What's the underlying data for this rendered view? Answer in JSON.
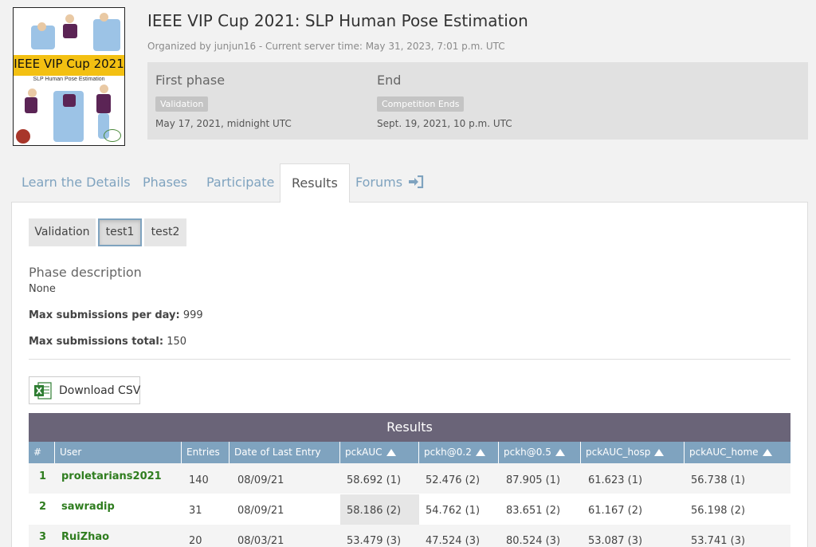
{
  "competition": {
    "title": "IEEE VIP Cup 2021: SLP Human Pose Estimation",
    "organized_by": "Organized by junjun16 - Current server time: May 31, 2023, 7:01 p.m. UTC",
    "logo_title": "IEEE VIP Cup 2021",
    "logo_subtitle": "SLP Human Pose Estimation"
  },
  "phases": [
    {
      "title": "First phase",
      "badge": "Validation",
      "date": "May 17, 2021, midnight UTC"
    },
    {
      "title": "End",
      "badge": "Competition Ends",
      "date": "Sept. 19, 2021, 10 p.m. UTC"
    }
  ],
  "tabs": [
    {
      "label": "Learn the Details"
    },
    {
      "label": "Phases"
    },
    {
      "label": "Participate"
    },
    {
      "label": "Results"
    },
    {
      "label": "Forums"
    }
  ],
  "phase_buttons": [
    {
      "label": "Validation"
    },
    {
      "label": "test1"
    },
    {
      "label": "test2"
    }
  ],
  "phase_info": {
    "desc_title": "Phase description",
    "desc": "None",
    "max_day_label": "Max submissions per day:",
    "max_day_value": "999",
    "max_total_label": "Max submissions total:",
    "max_total_value": "150"
  },
  "download_label": "Download CSV",
  "results": {
    "title": "Results",
    "columns": [
      "#",
      "User",
      "Entries",
      "Date of Last Entry",
      "pckAUC",
      "pckh@0.2",
      "pckh@0.5",
      "pckAUC_hosp",
      "pckAUC_home"
    ],
    "rows": [
      [
        "1",
        "proletarians2021",
        "140",
        "08/09/21",
        "58.692 (1)",
        "52.476 (2)",
        "87.905 (1)",
        "61.623 (1)",
        "56.738 (1)"
      ],
      [
        "2",
        "sawradip",
        "31",
        "08/09/21",
        "58.186 (2)",
        "54.762 (1)",
        "83.651 (2)",
        "61.167 (2)",
        "56.198 (2)"
      ],
      [
        "3",
        "RuiZhao",
        "20",
        "08/03/21",
        "53.479 (3)",
        "47.524 (3)",
        "80.524 (3)",
        "53.087 (3)",
        "53.741 (3)"
      ]
    ]
  },
  "colors": {
    "header_purple": "#6a6478",
    "header_blue": "#7fa3bf",
    "user_green": "#2f7d1f"
  }
}
